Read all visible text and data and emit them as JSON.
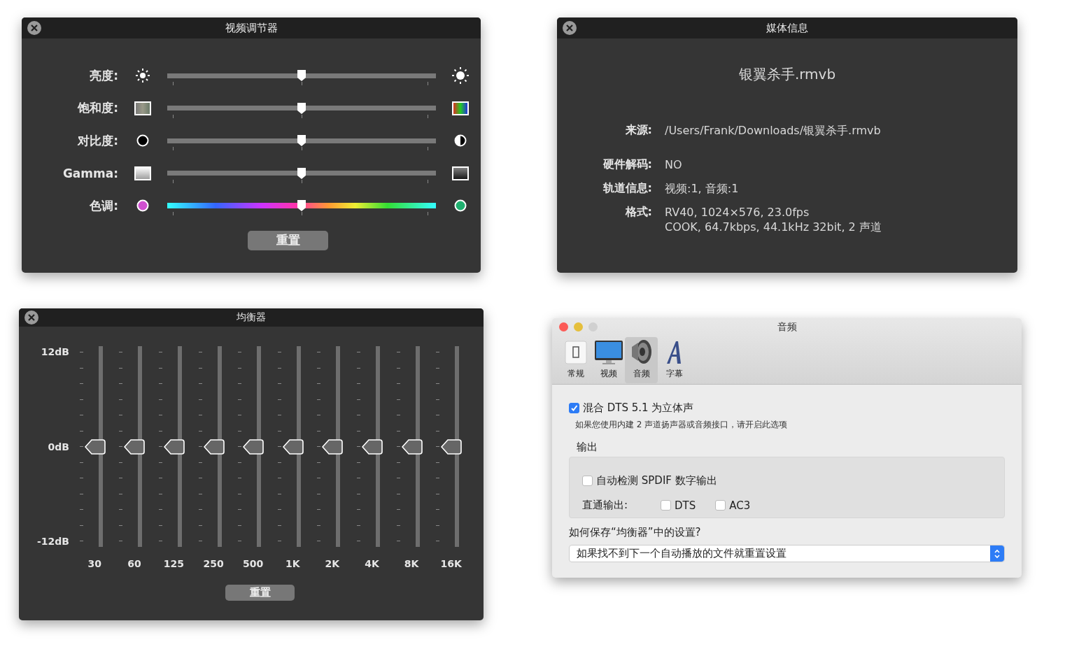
{
  "video_adjuster": {
    "title": "视频调节器",
    "sliders": [
      {
        "label": "亮度:",
        "kind": "brightness",
        "level": 0.5
      },
      {
        "label": "饱和度:",
        "kind": "saturation",
        "level": 0.5
      },
      {
        "label": "对比度:",
        "kind": "contrast",
        "level": 0.5
      },
      {
        "label": "Gamma:",
        "kind": "gamma",
        "level": 0.5
      },
      {
        "label": "色调:",
        "kind": "hue",
        "level": 0.5
      }
    ],
    "reset_button": "重置"
  },
  "media_info": {
    "title": "媒体信息",
    "filename": "银翼杀手.rmvb",
    "rows": [
      {
        "label": "来源:",
        "values": [
          "/Users/Frank/Downloads/银翼杀手.rmvb"
        ]
      },
      {
        "label": "硬件解码:",
        "values": [
          "NO"
        ]
      },
      {
        "label": "轨道信息:",
        "values": [
          "视频:1, 音频:1"
        ]
      },
      {
        "label": "格式:",
        "values": [
          "RV40, 1024×576, 23.0fps",
          "COOK, 64.7kbps, 44.1kHz 32bit, 2 声道"
        ]
      }
    ]
  },
  "equalizer": {
    "title": "均衡器",
    "scale": [
      "12dB",
      "0dB",
      "-12dB"
    ],
    "bands": [
      {
        "label": "30",
        "level": 0.5
      },
      {
        "label": "60",
        "level": 0.5
      },
      {
        "label": "125",
        "level": 0.5
      },
      {
        "label": "250",
        "level": 0.5
      },
      {
        "label": "500",
        "level": 0.5
      },
      {
        "label": "1K",
        "level": 0.5
      },
      {
        "label": "2K",
        "level": 0.5
      },
      {
        "label": "4K",
        "level": 0.5
      },
      {
        "label": "8K",
        "level": 0.5
      },
      {
        "label": "16K",
        "level": 0.5
      }
    ],
    "reset_button": "重置"
  },
  "audio_preferences": {
    "title": "音频",
    "tabs": [
      {
        "label": "常规",
        "kind": "general",
        "selected": false
      },
      {
        "label": "视频",
        "kind": "video",
        "selected": false
      },
      {
        "label": "音频",
        "kind": "audio",
        "selected": true
      },
      {
        "label": "字幕",
        "kind": "subtitle",
        "selected": false
      }
    ],
    "mix_dts": {
      "label": "混合 DTS 5.1 为立体声",
      "checked": true
    },
    "hint": "如果您使用内建 2 声道扬声器或音频接口，请开启此选项",
    "output": {
      "title": "输出",
      "auto_detect": {
        "label": "自动检测 SPDIF 数字输出",
        "checked": false
      },
      "passthrough_label": "直通输出:",
      "passthrough": [
        {
          "label": "DTS",
          "checked": false
        },
        {
          "label": "AC3",
          "checked": false
        }
      ]
    },
    "save_question": "如何保存“均衡器”中的设置?",
    "save_select": {
      "value": "如果找不到下一个自动播放的文件就重置设置"
    }
  }
}
